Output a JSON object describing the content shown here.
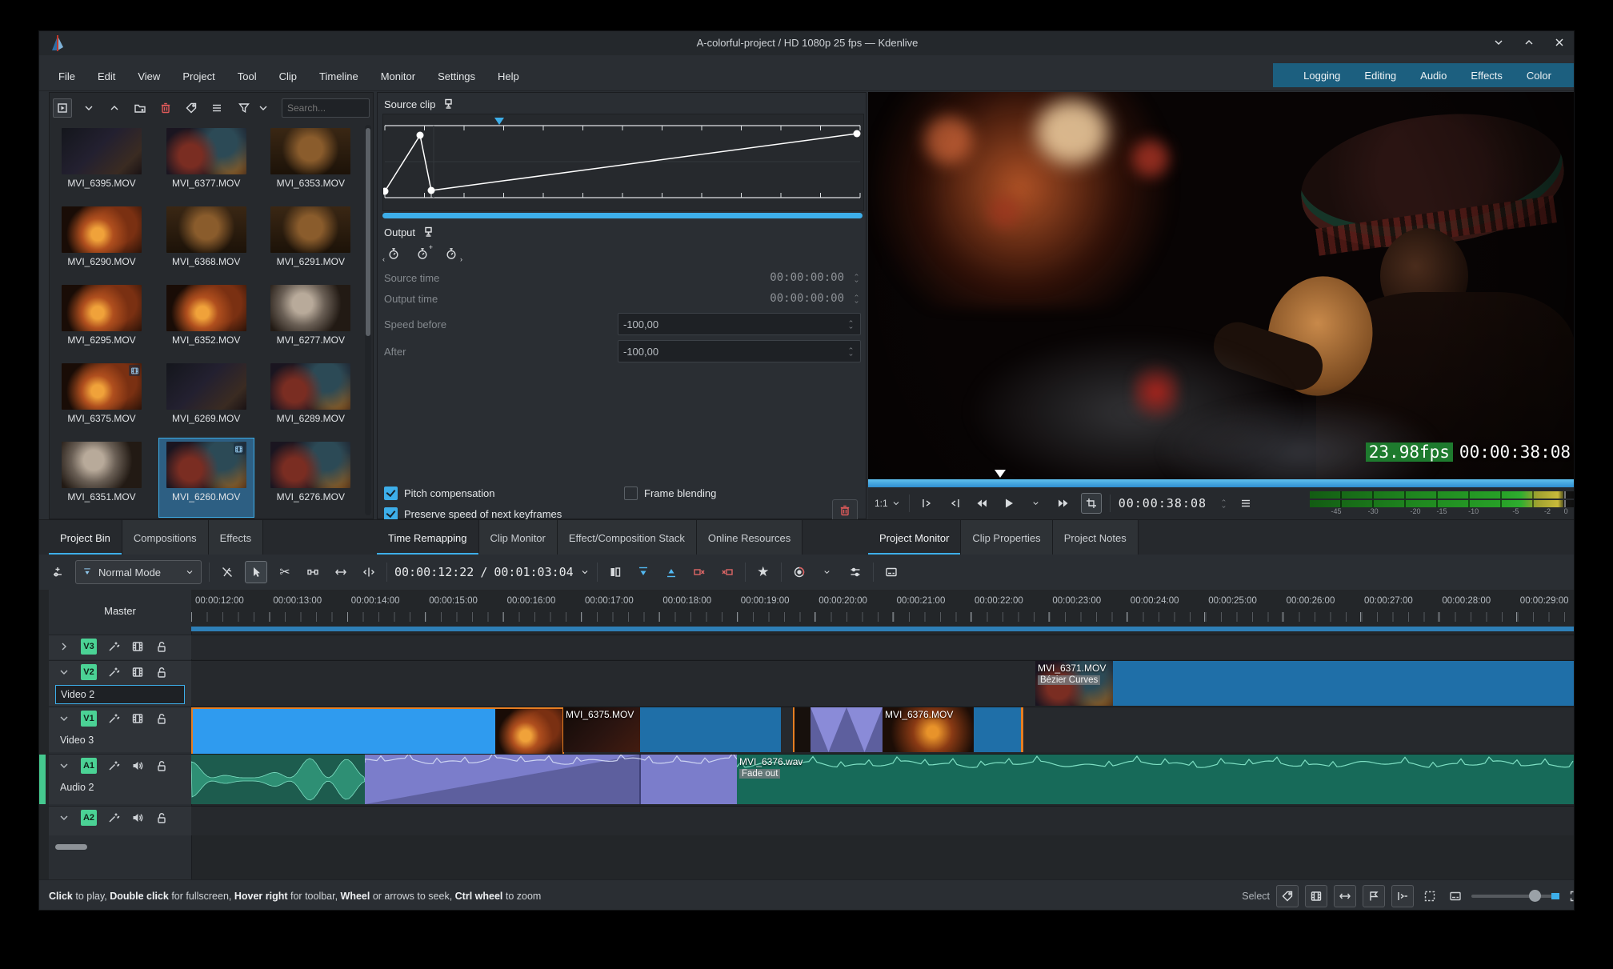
{
  "window": {
    "title": "A-colorful-project / HD 1080p 25 fps — Kdenlive"
  },
  "menus": [
    "File",
    "Edit",
    "View",
    "Project",
    "Tool",
    "Clip",
    "Timeline",
    "Monitor",
    "Settings",
    "Help"
  ],
  "workspaces": [
    "Logging",
    "Editing",
    "Audio",
    "Effects",
    "Color"
  ],
  "bin": {
    "search_placeholder": "Search...",
    "clips": [
      {
        "name": "MVI_6395.MOV",
        "tone": "dark"
      },
      {
        "name": "MVI_6377.MOV",
        "tone": "stage"
      },
      {
        "name": "MVI_6353.MOV",
        "tone": "barrels"
      },
      {
        "name": "MVI_6290.MOV",
        "tone": "fire"
      },
      {
        "name": "MVI_6368.MOV",
        "tone": "barrels"
      },
      {
        "name": "MVI_6291.MOV",
        "tone": "barrels"
      },
      {
        "name": "MVI_6295.MOV",
        "tone": "fire"
      },
      {
        "name": "MVI_6352.MOV",
        "tone": "fire"
      },
      {
        "name": "MVI_6277.MOV",
        "tone": "smoke"
      },
      {
        "name": "MVI_6375.MOV",
        "tone": "fire",
        "badge": true
      },
      {
        "name": "MVI_6269.MOV",
        "tone": "dark"
      },
      {
        "name": "MVI_6289.MOV",
        "tone": "stage"
      },
      {
        "name": "MVI_6351.MOV",
        "tone": "smoke"
      },
      {
        "name": "MVI_6260.MOV",
        "tone": "stage",
        "badge": true,
        "selected": true
      },
      {
        "name": "MVI_6276.MOV",
        "tone": "stage"
      }
    ],
    "tabs": [
      {
        "label": "Project Bin",
        "active": true
      },
      {
        "label": "Compositions"
      },
      {
        "label": "Effects"
      }
    ]
  },
  "remap": {
    "source_label": "Source clip",
    "output_label": "Output",
    "rows": [
      {
        "label": "Source time",
        "value": "00:00:00:00",
        "boxed": false
      },
      {
        "label": "Output time",
        "value": "00:00:00:00",
        "boxed": false
      },
      {
        "label": "Speed before",
        "value": "-100,00",
        "boxed": true
      },
      {
        "label": "After",
        "value": "-100,00",
        "boxed": true
      }
    ],
    "checks": [
      {
        "label": "Pitch compensation",
        "checked": true,
        "col": 0,
        "row": 0
      },
      {
        "label": "Frame blending",
        "checked": false,
        "col": 1,
        "row": 0
      },
      {
        "label": "Preserve speed of next keyframes",
        "checked": true,
        "col": 0,
        "row": 1
      }
    ],
    "tabs": [
      {
        "label": "Time Remapping",
        "active": true
      },
      {
        "label": "Clip Monitor"
      },
      {
        "label": "Effect/Composition Stack"
      },
      {
        "label": "Online Resources"
      }
    ]
  },
  "monitor": {
    "fps_overlay": "23.98fps",
    "tc_overlay": "00:00:38:08",
    "zoom_label": "1:1",
    "timecode": "00:00:38:08",
    "meter_ticks": [
      {
        "label": "-45",
        "pos": 10
      },
      {
        "label": "-30",
        "pos": 24
      },
      {
        "label": "-20",
        "pos": 40
      },
      {
        "label": "-15",
        "pos": 50
      },
      {
        "label": "-10",
        "pos": 62
      },
      {
        "label": "-5",
        "pos": 78
      },
      {
        "label": "-2",
        "pos": 90
      },
      {
        "label": "0",
        "pos": 97
      }
    ],
    "tabs": [
      {
        "label": "Project Monitor",
        "active": true
      },
      {
        "label": "Clip Properties"
      },
      {
        "label": "Project Notes"
      }
    ]
  },
  "ttoolbar": {
    "mode": "Normal Mode",
    "position": "00:00:12:22",
    "separator": "/",
    "duration": "00:01:03:04"
  },
  "timeline": {
    "master": "Master",
    "ruler": [
      "00:00:12:00",
      "00:00:13:00",
      "00:00:14:00",
      "00:00:15:00",
      "00:00:16:00",
      "00:00:17:00",
      "00:00:18:00",
      "00:00:19:00",
      "00:00:20:00",
      "00:00:21:00",
      "00:00:22:00",
      "00:00:23:00",
      "00:00:24:00",
      "00:00:25:00",
      "00:00:26:00",
      "00:00:27:00",
      "00:00:28:00",
      "00:00:29:00"
    ],
    "tracks": [
      {
        "id": "V3"
      },
      {
        "id": "V2",
        "name": "Video 2"
      },
      {
        "id": "V1",
        "name": "Video 3"
      },
      {
        "id": "A1",
        "name": "Audio 2"
      },
      {
        "id": "A2"
      }
    ],
    "clips": {
      "v2_clip": {
        "label": "MVI_6371.MOV",
        "effect": "Bézier Curves"
      },
      "v1_clip2": {
        "label": "MVI_6375.MOV"
      },
      "v1_clip3": {
        "label": "MVI_6376.MOV"
      },
      "a1_clip3": {
        "label": "MVI_6376.wav",
        "effect": "Fade out"
      }
    }
  },
  "status": {
    "hint": [
      [
        "Click",
        1
      ],
      [
        " to play, ",
        0
      ],
      [
        "Double click",
        1
      ],
      [
        " for fullscreen, ",
        0
      ],
      [
        "Hover right",
        1
      ],
      [
        " for toolbar, ",
        0
      ],
      [
        "Wheel",
        1
      ],
      [
        " or arrows to seek, ",
        0
      ],
      [
        "Ctrl wheel",
        1
      ],
      [
        " to zoom",
        0
      ]
    ],
    "select_label": "Select"
  }
}
